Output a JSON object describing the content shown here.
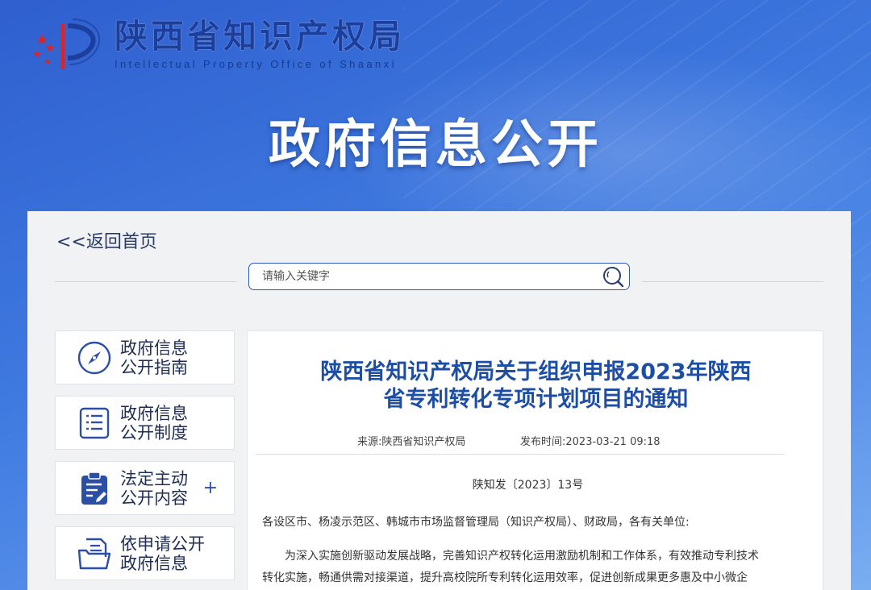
{
  "header": {
    "org_name_cn": "陕西省知识产权局",
    "org_name_en": "Intellectual Property Office of Shaanxi",
    "banner_title": "政府信息公开"
  },
  "nav": {
    "back_label": "<<返回首页",
    "search_placeholder": "请输入关键字",
    "sidebar": [
      {
        "label": "政府信息\n公开指南",
        "icon": "compass-icon"
      },
      {
        "label": "政府信息\n公开制度",
        "icon": "list-document-icon"
      },
      {
        "label": "法定主动\n公开内容",
        "icon": "clipboard-edit-icon",
        "expand": "+"
      },
      {
        "label": "依申请公开\n政府信息",
        "icon": "folder-document-icon"
      }
    ]
  },
  "article": {
    "title": "陕西省知识产权局关于组织申报2023年陕西\n省专利转化专项计划项目的通知",
    "source_label": "来源:",
    "source": "陕西省知识产权局",
    "time_label": "发布时间:",
    "time": "2023-03-21 09:18",
    "doc_number": "陕知发〔2023〕13号",
    "salutation": "各设区市、杨凌示范区、韩城市市场监督管理局（知识产权局）、财政局，各有关单位:",
    "body_line1": "为深入实施创新驱动发展战略，完善知识产权转化运用激励机制和工作体系，有效推动专利技术",
    "body_line2": "转化实施，畅通供需对接渠道，提升高校院所专利转化运用效率，促进创新成果更多惠及中小微企"
  },
  "colors": {
    "accent": "#2c58b9",
    "title_blue": "#1d4ea6",
    "logo_red": "#d9262b"
  }
}
